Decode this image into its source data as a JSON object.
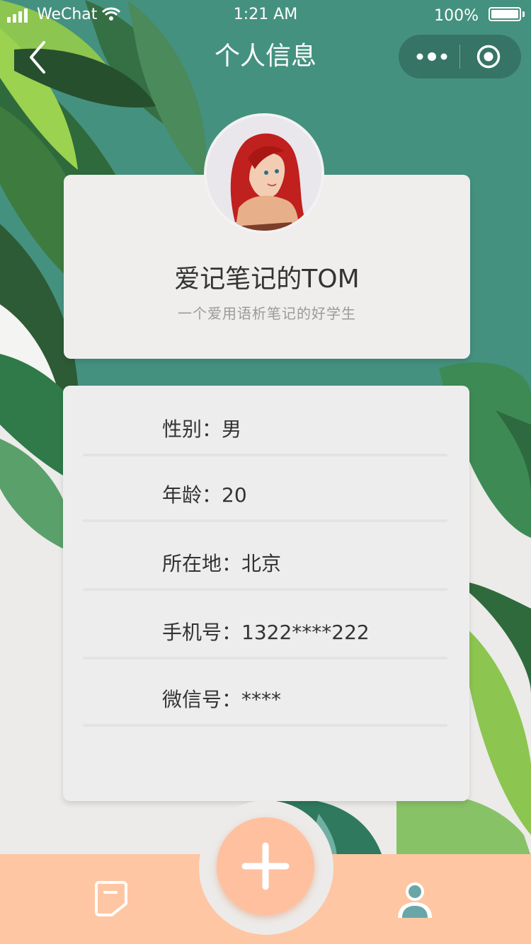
{
  "status_bar": {
    "carrier": "WeChat",
    "time": "1:21 AM",
    "battery_percent": "100%",
    "icons": [
      "signal-icon",
      "wifi-icon",
      "battery-icon"
    ]
  },
  "nav": {
    "title": "个人信息",
    "icons": [
      "back-icon",
      "more-icon",
      "target-icon"
    ]
  },
  "profile": {
    "name": "爱记笔记的TOM",
    "motto": "一个爱用语析笔记的好学生"
  },
  "info": {
    "gender": "性别：男",
    "age": "年龄：20",
    "location": "所在地：北京",
    "phone": "手机号：1322****222",
    "wechat": "微信号：****"
  },
  "tabbar": {
    "icons": [
      "notes-icon",
      "add-icon",
      "user-icon"
    ]
  },
  "colors": {
    "teal_background": "#45917f",
    "tabbar": "#ffc6a3",
    "add_button": "#ffc0a0",
    "card": "#efeeed"
  }
}
